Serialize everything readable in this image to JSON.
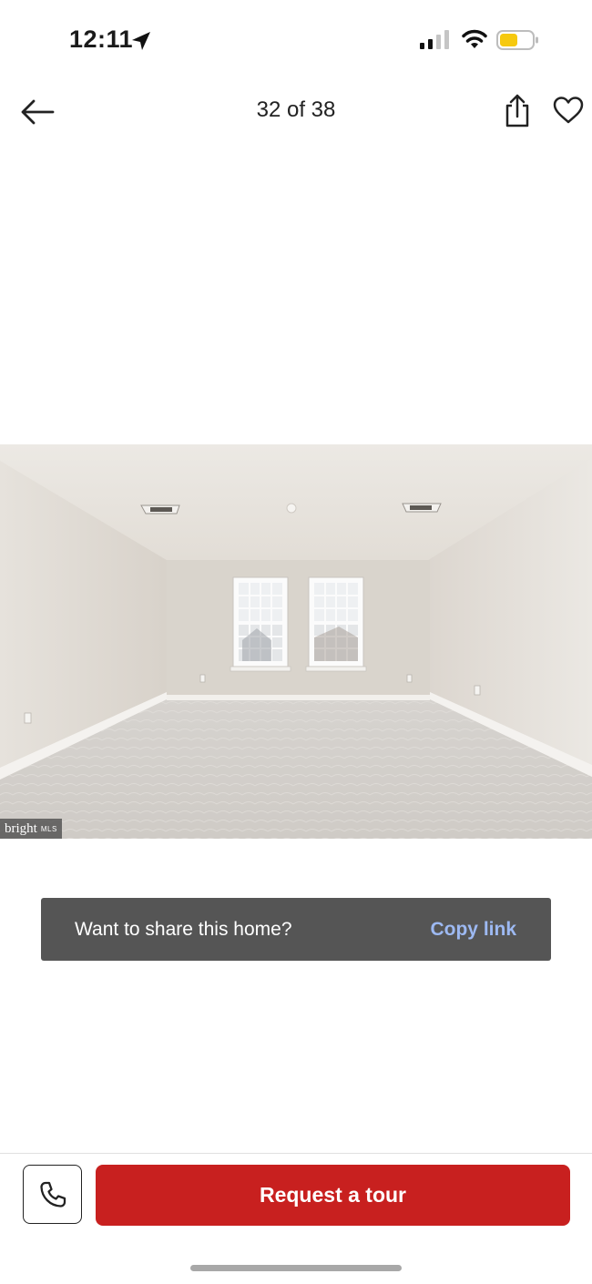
{
  "status_bar": {
    "time": "12:11",
    "location_icon": "location-arrow-icon",
    "signal_icon": "cellular-signal-icon",
    "wifi_icon": "wifi-icon",
    "battery_icon": "battery-icon",
    "battery_color": "#f6c90e"
  },
  "header": {
    "back_icon": "arrow-left-icon",
    "photo_counter": "32 of 38",
    "share_icon": "share-icon",
    "favorite_icon": "heart-icon"
  },
  "photo": {
    "watermark_brand": "bright",
    "watermark_suffix": "MLS"
  },
  "share_toast": {
    "message": "Want to share this home?",
    "action_label": "Copy link",
    "background": "#555555",
    "action_color": "#9db9f2"
  },
  "bottom_bar": {
    "call_icon": "phone-icon",
    "primary_action": "Request a tour",
    "primary_color": "#c8201f"
  }
}
